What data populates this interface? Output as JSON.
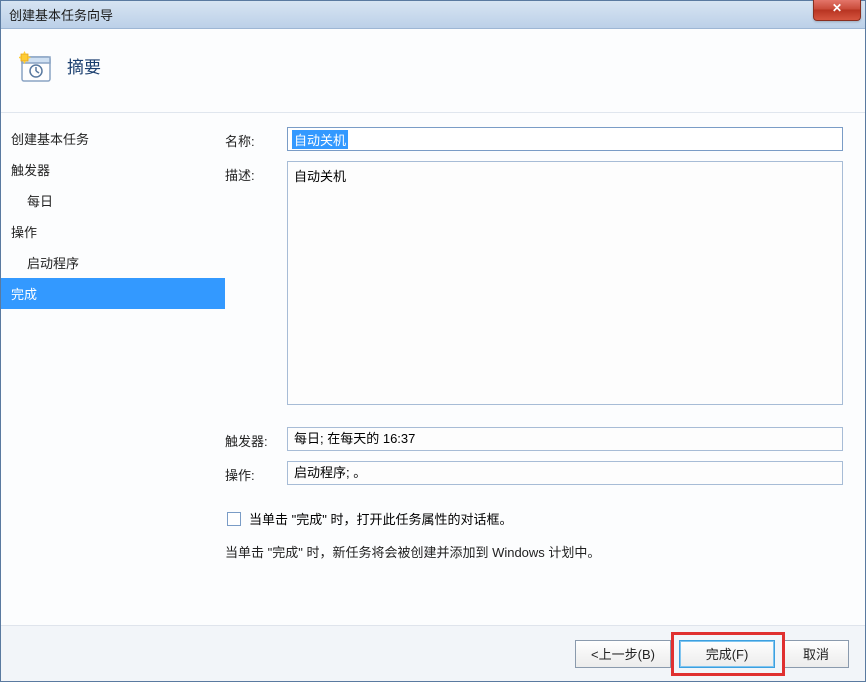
{
  "window": {
    "title": "创建基本任务向导"
  },
  "header": {
    "title": "摘要"
  },
  "sidebar": {
    "items": [
      {
        "label": "创建基本任务",
        "indent": false
      },
      {
        "label": "触发器",
        "indent": false
      },
      {
        "label": "每日",
        "indent": true
      },
      {
        "label": "操作",
        "indent": false
      },
      {
        "label": "启动程序",
        "indent": true
      },
      {
        "label": "完成",
        "indent": false
      }
    ]
  },
  "form": {
    "name_label": "名称:",
    "name_value": "自动关机",
    "desc_label": "描述:",
    "desc_value": "自动关机",
    "trigger_label": "触发器:",
    "trigger_value": "每日; 在每天的 16:37",
    "action_label": "操作:",
    "action_value": "启动程序; 。",
    "checkbox_label": "当单击 \"完成\" 时，打开此任务属性的对话框。",
    "info_text": "当单击 \"完成\" 时，新任务将会被创建并添加到 Windows 计划中。"
  },
  "buttons": {
    "back": "<上一步(B)",
    "finish": "完成(F)",
    "cancel": "取消"
  }
}
